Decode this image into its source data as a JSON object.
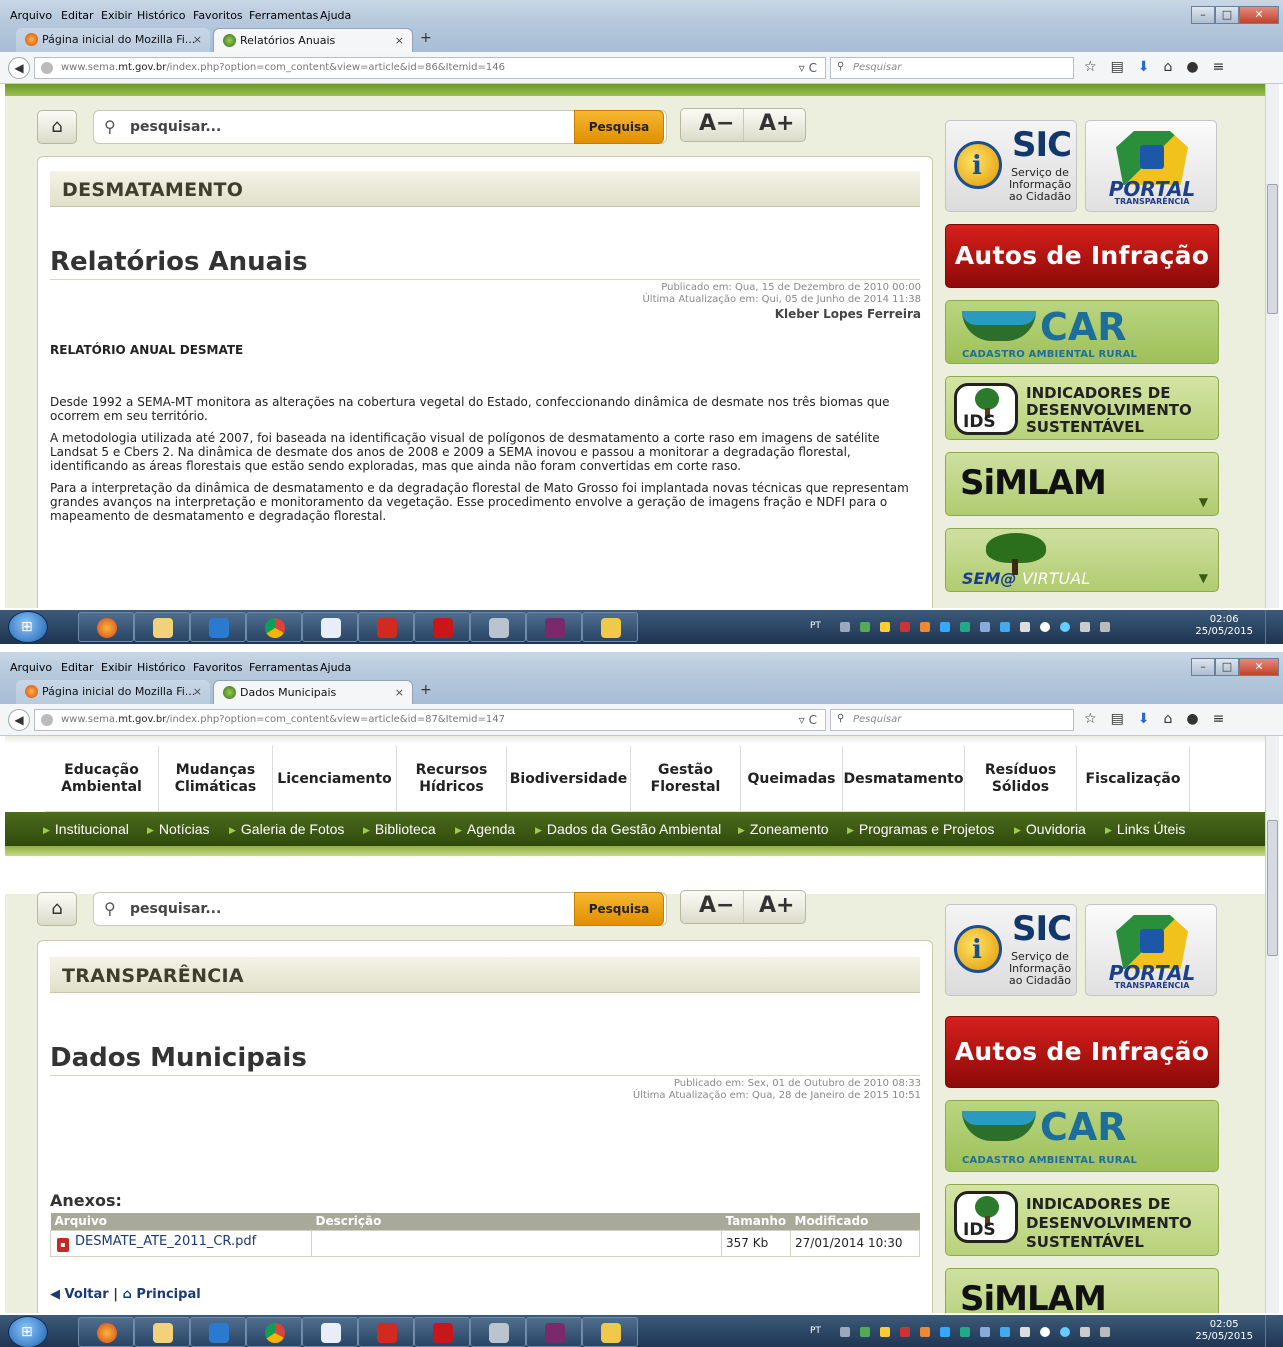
{
  "browser": {
    "menu": [
      "Arquivo",
      "Editar",
      "Exibir",
      "Histórico",
      "Favoritos",
      "Ferramentas",
      "Ajuda"
    ],
    "tab_home_label": "Página inicial do Mozilla Fi...",
    "search_placeholder": "Pesquisar",
    "url_prefix": "www.sema.",
    "url_domain": "mt.gov.br",
    "tab_close": "×",
    "new_tab": "+"
  },
  "screenshot1": {
    "tab_active_label": "Relatórios Anuais",
    "url_path": "/index.php?option=com_content&view=article&id=86&Itemid=146",
    "search_label": "pesquisar...",
    "search_button": "Pesquisa",
    "font_decrease": "A−",
    "font_increase": "A+",
    "category": "DESMATAMENTO",
    "title": "Relatórios Anuais",
    "published": "Publicado em: Qua, 15 de Dezembro de 2010 00:00",
    "updated": "Última Atualização em: Qui, 05 de Junho de 2014 11:38",
    "author": "Kleber Lopes Ferreira",
    "heading": "RELATÓRIO ANUAL DESMATE",
    "paragraphs": [
      "Desde 1992 a SEMA-MT monitora as alterações na cobertura vegetal do Estado, confeccionando dinâmica de desmate nos três biomas que ocorrem em seu território.",
      "A metodologia utilizada até 2007, foi baseada na identificação visual de polígonos de desmatamento a corte raso em imagens de satélite Landsat 5 e Cbers 2. Na dinâmica de desmate dos anos de 2008 e 2009 a SEMA inovou e passou a monitorar a degradação florestal, identificando as áreas florestais que estão sendo exploradas, mas que ainda não foram convertidas em corte raso.",
      "Para a interpretação da dinâmica de desmatamento e da degradação florestal de Mato Grosso foi implantada novas técnicas que representam grandes avanços na interpretação e monitoramento da vegetação. Esse procedimento envolve a geração de imagens fração e NDFI para o mapeamento de desmatamento e degradação florestal."
    ],
    "clock_time": "02:06",
    "clock_date": "25/05/2015"
  },
  "screenshot2": {
    "tab_active_label": "Dados Municipais",
    "url_path": "/index.php?option=com_content&view=article&id=87&Itemid=147",
    "main_nav": [
      {
        "line1": "Educação",
        "line2": "Ambiental"
      },
      {
        "line1": "Mudanças",
        "line2": "Climáticas"
      },
      {
        "line1": "Licenciamento",
        "line2": ""
      },
      {
        "line1": "Recursos",
        "line2": "Hídricos"
      },
      {
        "line1": "Biodiversidade",
        "line2": ""
      },
      {
        "line1": "Gestão",
        "line2": "Florestal"
      },
      {
        "line1": "Queimadas",
        "line2": ""
      },
      {
        "line1": "Desmatamento",
        "line2": ""
      },
      {
        "line1": "Resíduos",
        "line2": "Sólidos"
      },
      {
        "line1": "Fiscalização",
        "line2": ""
      }
    ],
    "sub_nav": [
      "Institucional",
      "Notícias",
      "Galeria de Fotos",
      "Biblioteca",
      "Agenda",
      "Dados da Gestão Ambiental",
      "Zoneamento",
      "Programas e Projetos",
      "Ouvidoria",
      "Links Úteis"
    ],
    "search_label": "pesquisar...",
    "search_button": "Pesquisa",
    "font_decrease": "A−",
    "font_increase": "A+",
    "category": "TRANSPARÊNCIA",
    "title": "Dados Municipais",
    "published": "Publicado em: Sex, 01 de Outubro de 2010 08:33",
    "updated": "Última Atualização em: Qua, 28 de Janeiro de 2015 10:51",
    "anexos_title": "Anexos:",
    "table_headers": [
      "Arquivo",
      "Descrição",
      "Tamanho",
      "Modificado"
    ],
    "table_rows": [
      {
        "file": "DESMATE_ATE_2011_CR.pdf",
        "desc": "",
        "size": "357 Kb",
        "modified": "27/01/2014 10:30"
      }
    ],
    "voltar": "Voltar",
    "principal": "Principal",
    "clock_time": "02:05",
    "clock_date": "25/05/2015"
  },
  "sidebar": {
    "sic_big": "SIC",
    "sic_small": "Serviço de Informação ao Cidadão",
    "portal_big": "PORTAL",
    "portal_small": "TRANSPARÊNCIA",
    "autos": "Autos de Infração",
    "car_big": "CAR",
    "car_small": "CADASTRO AMBIENTAL RURAL",
    "ids_logo": "IDS",
    "ids_line1": "INDICADORES DE",
    "ids_line2": "DESENVOLVIMENTO",
    "ids_line3": "SUSTENTÁVEL",
    "simlam": "SiMLAM",
    "semv_a": "SEM@",
    "semv_b": "VIRTUAL"
  },
  "taskbar": {
    "lang": "PT"
  },
  "colors": {
    "page_bg": "#ecefdd",
    "green_bar": "#6a9a2a",
    "subnav_bg": "#3c5a14",
    "search_btn": "#f0a520",
    "autos_red": "#c0161a",
    "table_header": "#a9a99a"
  }
}
